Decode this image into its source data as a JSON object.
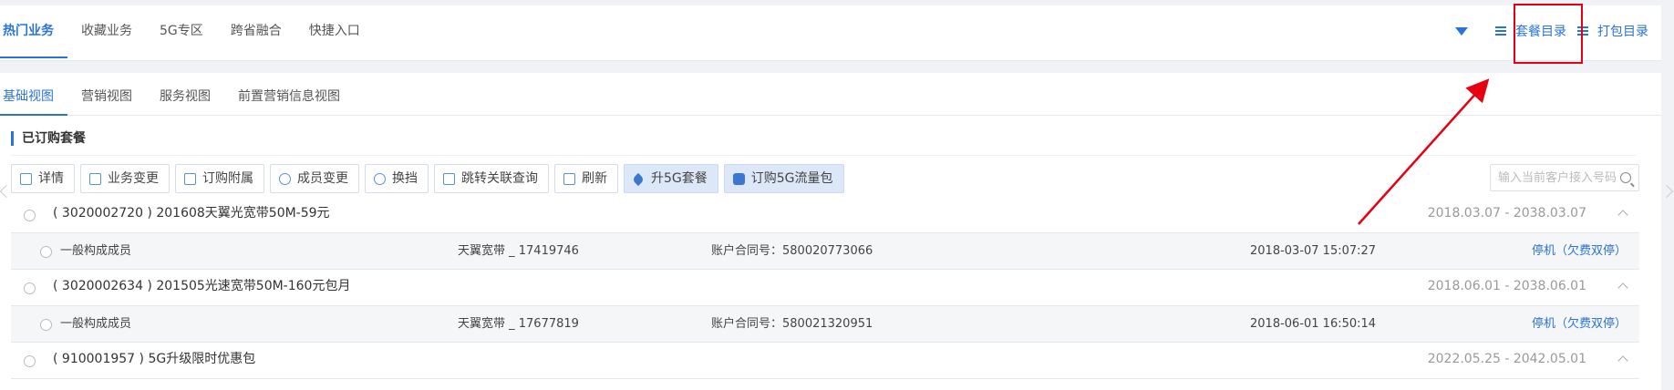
{
  "top_tabs": [
    "热门业务",
    "收藏业务",
    "5G专区",
    "跨省融合",
    "快捷入口"
  ],
  "top_links": {
    "package_catalog": "套餐目录",
    "bundle_catalog": "打包目录"
  },
  "view_tabs": [
    "基础视图",
    "营销视图",
    "服务视图",
    "前置营销信息视图"
  ],
  "section": {
    "title": "已订购套餐"
  },
  "toolbar": {
    "buttons": [
      "详情",
      "业务变更",
      "订购附属",
      "成员变更",
      "换挡",
      "跳转关联查询",
      "刷新",
      "升5G套餐",
      "订购5G流量包"
    ]
  },
  "search": {
    "placeholder": "输入当前客户接入号码",
    "value": ""
  },
  "packages": [
    {
      "name": "( 3020002720 ) 201608天翼光宽带50M-59元",
      "dates": "2018.03.07 - 2038.03.07",
      "member": {
        "role": "一般构成成员",
        "product": "天翼宽带 _ 17419746",
        "account": "账户合同号：580020773066",
        "time": "2018-03-07 15:07:27",
        "status": "停机（欠费双停）"
      }
    },
    {
      "name": "( 3020002634 ) 201505光速宽带50M-160元包月",
      "dates": "2018.06.01 - 2038.06.01",
      "member": {
        "role": "一般构成成员",
        "product": "天翼宽带 _ 17677819",
        "account": "账户合同号：580021320951",
        "time": "2018-06-01 16:50:14",
        "status": "停机（欠费双停）"
      }
    },
    {
      "name": "( 910001957 ) 5G升级限时优惠包",
      "dates": "2022.05.25 - 2042.05.01"
    }
  ],
  "colors": {
    "accent": "#2a73d8",
    "annotation": "#e60012"
  }
}
